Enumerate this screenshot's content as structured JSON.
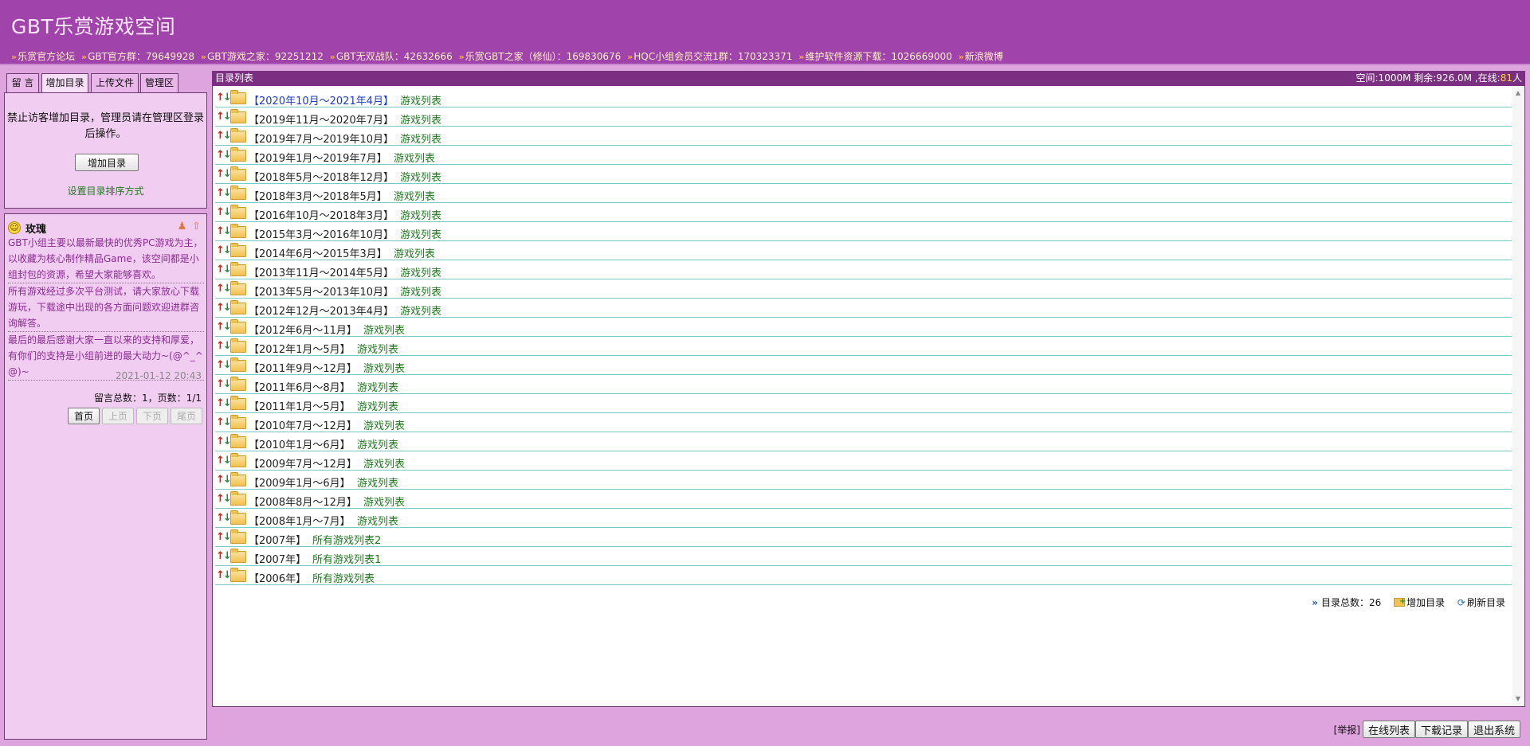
{
  "header": {
    "title": "GBT乐赏游戏空间",
    "links": [
      "乐赏官方论坛",
      "GBT官方群：79649928",
      "GBT游戏之家：92251212",
      "GBT无双战队：42632666",
      "乐赏GBT之家（修仙）：169830676",
      "HQC小组会员交流1群：170323371",
      "维护软件资源下载：1026669000",
      "新浪微博"
    ]
  },
  "left_tabs": [
    "留 言",
    "增加目录",
    "上传文件",
    "管理区"
  ],
  "admin_panel": {
    "message": "禁止访客增加目录，管理员请在管理区登录后操作。",
    "add_button": "增加目录",
    "sort_link": "设置目录排序方式"
  },
  "guestbook": {
    "author": "玫瑰",
    "paragraphs": [
      "GBT小组主要以最新最快的优秀PC游戏为主，以收藏为核心制作精品Game，该空间都是小组封包的资源，希望大家能够喜欢。",
      "所有游戏经过多次平台测试，请大家放心下载游玩，下载途中出现的各方面问题欢迎进群咨询解答。",
      "最后的最后感谢大家一直以来的支持和厚爱，有你们的支持是小组前进的最大动力~(@^_^@)~"
    ],
    "time": "2021-01-12 20:43",
    "pager_info": "留言总数：1，页数：1/1",
    "pager_buttons": [
      "首页",
      "上页",
      "下页",
      "尾页"
    ]
  },
  "main": {
    "title": "目录列表",
    "space_info": "空间:1000M 剩余:926.0M ,在线:",
    "online_count": "81",
    "online_unit": "人",
    "directories": [
      {
        "name": "【2020年10月～2021年4月】",
        "desc": "游戏列表"
      },
      {
        "name": "【2019年11月～2020年7月】",
        "desc": "游戏列表"
      },
      {
        "name": "【2019年7月～2019年10月】",
        "desc": "游戏列表"
      },
      {
        "name": "【2019年1月～2019年7月】",
        "desc": "游戏列表"
      },
      {
        "name": "【2018年5月～2018年12月】",
        "desc": "游戏列表"
      },
      {
        "name": "【2018年3月～2018年5月】",
        "desc": "游戏列表"
      },
      {
        "name": "【2016年10月～2018年3月】",
        "desc": "游戏列表"
      },
      {
        "name": "【2015年3月～2016年10月】",
        "desc": "游戏列表"
      },
      {
        "name": "【2014年6月～2015年3月】",
        "desc": "游戏列表"
      },
      {
        "name": "【2013年11月～2014年5月】",
        "desc": "游戏列表"
      },
      {
        "name": "【2013年5月～2013年10月】",
        "desc": "游戏列表"
      },
      {
        "name": "【2012年12月～2013年4月】",
        "desc": "游戏列表"
      },
      {
        "name": "【2012年6月～11月】",
        "desc": "游戏列表"
      },
      {
        "name": "【2012年1月～5月】",
        "desc": "游戏列表"
      },
      {
        "name": "【2011年9月～12月】",
        "desc": "游戏列表"
      },
      {
        "name": "【2011年6月～8月】",
        "desc": "游戏列表"
      },
      {
        "name": "【2011年1月～5月】",
        "desc": "游戏列表"
      },
      {
        "name": "【2010年7月～12月】",
        "desc": "游戏列表"
      },
      {
        "name": "【2010年1月～6月】",
        "desc": "游戏列表"
      },
      {
        "name": "【2009年7月～12月】",
        "desc": "游戏列表"
      },
      {
        "name": "【2009年1月～6月】",
        "desc": "游戏列表"
      },
      {
        "name": "【2008年8月～12月】",
        "desc": "游戏列表"
      },
      {
        "name": "【2008年1月～7月】",
        "desc": "游戏列表"
      },
      {
        "name": "【2007年】",
        "desc": "所有游戏列表2"
      },
      {
        "name": "【2007年】",
        "desc": "所有游戏列表1"
      },
      {
        "name": "【2006年】",
        "desc": "所有游戏列表"
      }
    ],
    "footer": {
      "total_label": "目录总数：",
      "total": "26",
      "add_label": "增加目录",
      "refresh_label": "刷新目录"
    }
  },
  "bottom_bar": {
    "report": "[举报]",
    "buttons": [
      "在线列表",
      "下载记录",
      "退出系统"
    ]
  },
  "colors": {
    "header_bg": "#a043aa",
    "page_bg": "#dea4de",
    "panel_bg": "#f1cef1",
    "link_green": "#1f7a1f",
    "active_blue": "#1a3ad0"
  }
}
